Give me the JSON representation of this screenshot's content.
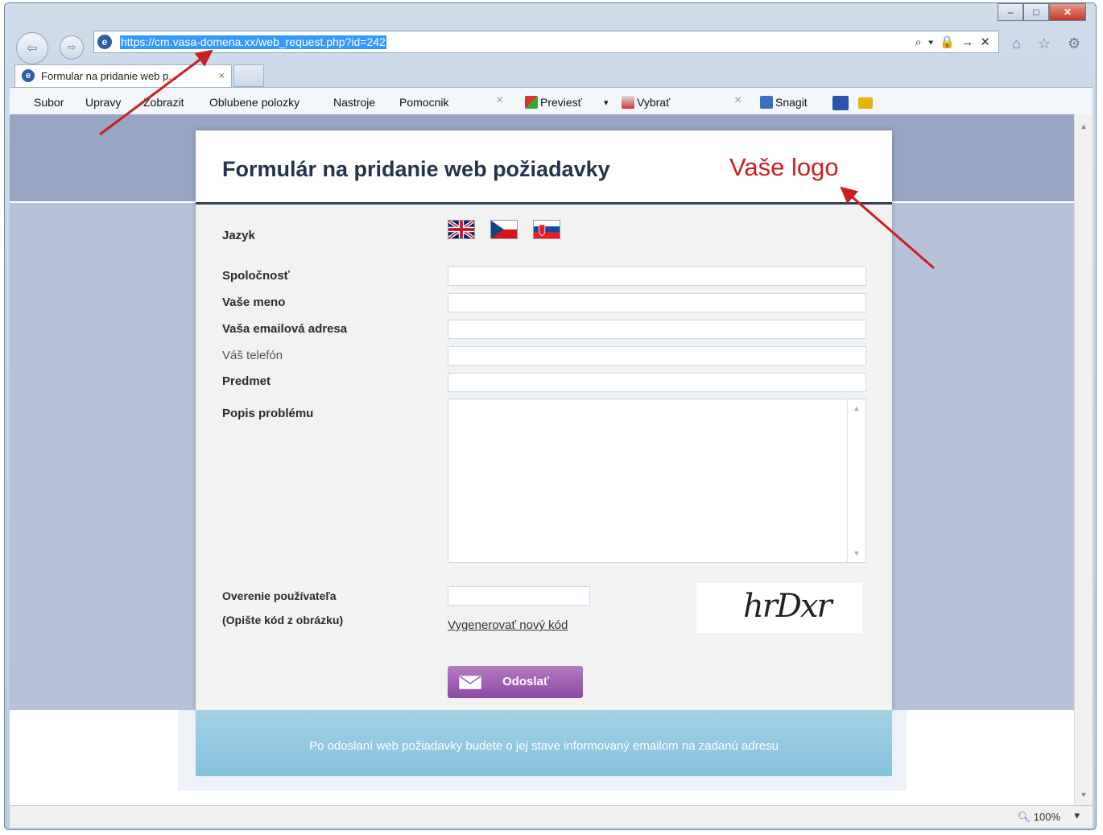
{
  "browser": {
    "url": "https://cm.vasa-domena.xx/web_request.php?id=242",
    "address_tools": "⌕ ▾ 🔒 → ✕",
    "right_icons": "⌂ ☆ ⚙",
    "tab_label": "Formular na pridanie web p...",
    "tab_close": "×",
    "window_buttons": {
      "minimize": "–",
      "maximize": "□",
      "close": "✕"
    },
    "nav": {
      "back": "⇦",
      "forward": "⇨"
    },
    "menu": [
      "Subor",
      "Upravy",
      "Zobrazit",
      "Oblubene polozky",
      "Nastroje",
      "Pomocnik"
    ],
    "command_bar": {
      "close1": "×",
      "preview": "Previesť",
      "preview_caret": "▾",
      "select": "Vybrať",
      "close2": "×",
      "snagit": "Snagit"
    },
    "status": {
      "zoom": "100%",
      "zoom_caret": "▾",
      "zoom_icon": "magnifier-icon"
    }
  },
  "form": {
    "title": "Formulár na pridanie web požiadavky",
    "logo_text": "Vaše logo",
    "language_label": "Jazyk",
    "flags": [
      "uk-flag-icon",
      "czech-flag-icon",
      "slovak-flag-icon"
    ],
    "fields": {
      "company": "Spoločnosť",
      "name": "Vaše meno",
      "email": "Vaša emailová adresa",
      "phone": "Váš telefón",
      "subject": "Predmet",
      "description": "Popis problému"
    },
    "captcha": {
      "label": "Overenie používateľa",
      "hint": "(Opište kód z obrázku)",
      "regenerate": "Vygenerovať nový kód",
      "code": "hrDxr"
    },
    "submit": "Odoslať",
    "footer": "Po odoslaní web požiadavky budete o jej stave informovaný emailom na zadanú adresu"
  },
  "colors": {
    "annotation_arrow": "#cc1f1f",
    "title_text": "#24344c",
    "submit_button": "#9a5bb0",
    "footer": "#93c9df"
  }
}
